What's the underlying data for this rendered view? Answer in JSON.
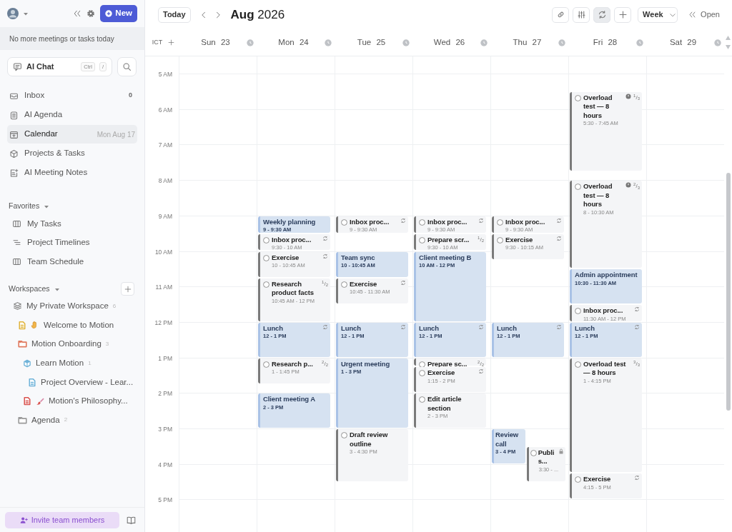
{
  "sidebar": {
    "new_button": "New",
    "banner": "No more meetings or tasks today",
    "ai_chat": {
      "label": "AI Chat",
      "shortcut": [
        "Ctrl",
        "/"
      ]
    },
    "nav": [
      {
        "kind": "inbox",
        "label": "Inbox",
        "count": "0",
        "selected": false
      },
      {
        "kind": "agenda",
        "label": "AI Agenda",
        "selected": false
      },
      {
        "kind": "calendar",
        "label": "Calendar",
        "note": "Mon Aug 17",
        "selected": true
      },
      {
        "kind": "projects",
        "label": "Projects & Tasks",
        "selected": false
      },
      {
        "kind": "notes",
        "label": "AI Meeting Notes",
        "selected": false
      }
    ],
    "favorites": {
      "title": "Favorites",
      "items": [
        {
          "kind": "board",
          "label": "My Tasks"
        },
        {
          "kind": "timeline",
          "label": "Project Timelines"
        },
        {
          "kind": "board",
          "label": "Team Schedule"
        }
      ]
    },
    "workspaces": {
      "title": "Workspaces",
      "tree": [
        {
          "kind": "workspace",
          "label": "My Private Workspace",
          "count": "6",
          "children": [
            {
              "kind": "welcome",
              "color": "#e0b43c",
              "label": "Welcome to Motion"
            },
            {
              "kind": "folder",
              "color": "#e07a5f",
              "label": "Motion Onboarding",
              "count": "3",
              "children": [
                {
                  "kind": "project",
                  "color": "#6fb3d9",
                  "label": "Learn Motion",
                  "count": "1",
                  "children": [
                    {
                      "kind": "doc",
                      "color": "#6fb3d9",
                      "label": "Project Overview - Lear..."
                    }
                  ]
                },
                {
                  "kind": "philosophy",
                  "color": "#d9534f",
                  "label": "Motion's Philosophy..."
                }
              ]
            },
            {
              "kind": "folder",
              "color": "#9a9a9a",
              "label": "Agenda",
              "count": "2"
            }
          ]
        }
      ]
    },
    "invite": "Invite team members"
  },
  "toolbar": {
    "today": "Today",
    "title": "**Aug** 2026",
    "tools": [
      {
        "kind": "link",
        "selected": false
      },
      {
        "kind": "sliders",
        "selected": false
      },
      {
        "kind": "sync",
        "selected": true
      },
      {
        "kind": "plus",
        "selected": false
      }
    ],
    "view": "Week",
    "open": "Open"
  },
  "timezone": "ICT",
  "hours": [
    "5 AM",
    "6 AM",
    "7 AM",
    "8 AM",
    "9 AM",
    "10 AM",
    "11 AM",
    "12 PM",
    "1 PM",
    "2 PM",
    "3 PM",
    "4 PM",
    "5 PM"
  ],
  "days": [
    {
      "label": "Sun 23"
    },
    {
      "label": "Mon 24",
      "events": [
        {
          "kind": "event",
          "title": "Weekly planning",
          "time": "9 - 9:30 AM"
        },
        {
          "kind": "task",
          "checked": false,
          "title": "Inbox proc...",
          "time": "9:30 - 10 AM",
          "recurring": true
        },
        {
          "kind": "task",
          "checked": false,
          "title": "Exercise",
          "time": "10 - 10:45 AM",
          "recurring": true
        },
        {
          "kind": "task",
          "checked": false,
          "title": "Research product facts",
          "time": "10:45 AM - 12 PM",
          "fraction": "$^{1}$/$_{2}$"
        },
        {
          "kind": "event",
          "title": "Lunch",
          "time": "12 - 1 PM",
          "recurring": true
        },
        {
          "kind": "task",
          "checked": false,
          "title": "Research p...",
          "time": "1 - 1:45 PM",
          "fraction": "$^{2}$/$_{2}$"
        },
        {
          "kind": "event",
          "title": "Client meeting A",
          "time": "2 - 3 PM"
        }
      ]
    },
    {
      "label": "Tue 25",
      "events": [
        {
          "kind": "task",
          "checked": false,
          "title": "Inbox proc...",
          "time": "9 - 9:30 AM",
          "recurring": true
        },
        {
          "kind": "event",
          "title": "Team sync",
          "time": "10 - 10:45 AM"
        },
        {
          "kind": "task",
          "checked": false,
          "title": "Exercise",
          "time": "10:45 - 11:30 AM",
          "recurring": true
        },
        {
          "kind": "event",
          "title": "Lunch",
          "time": "12 - 1 PM",
          "recurring": true
        },
        {
          "kind": "event",
          "title": "Urgent meeting",
          "time": "1 - 3 PM"
        },
        {
          "kind": "task",
          "checked": false,
          "title": "Draft review outline",
          "time": "3 - 4:30 PM"
        }
      ]
    },
    {
      "label": "Wed 26",
      "events": [
        {
          "kind": "task",
          "checked": false,
          "title": "Inbox proc...",
          "time": "9 - 9:30 AM",
          "recurring": true
        },
        {
          "kind": "task",
          "checked": false,
          "title": "Prepare scr...",
          "time": "9:30 - 10 AM",
          "fraction": "$^{1}$/$_{2}$"
        },
        {
          "kind": "event",
          "title": "Client meeting B",
          "time": "10 AM - 12 PM"
        },
        {
          "kind": "event",
          "title": "Lunch",
          "time": "12 - 1 PM",
          "recurring": true
        },
        {
          "kind": "task",
          "checked": false,
          "title": "Prepare sc...",
          "fraction": "$^{2}$/$_{2}$"
        },
        {
          "kind": "task",
          "checked": false,
          "title": "Exercise",
          "time": "1:15 - 2 PM",
          "recurring": true
        },
        {
          "kind": "task",
          "checked": false,
          "title": "Edit article section",
          "time": "2 - 3 PM"
        }
      ]
    },
    {
      "label": "Thu 27",
      "events": [
        {
          "kind": "task",
          "checked": false,
          "title": "Inbox proc...",
          "time": "9 - 9:30 AM",
          "recurring": true
        },
        {
          "kind": "task",
          "checked": false,
          "title": "Exercise",
          "time": "9:30 - 10:15 AM",
          "recurring": true
        },
        {
          "kind": "event",
          "title": "Lunch",
          "time": "12 - 1 PM",
          "recurring": true
        },
        {
          "kind": "event",
          "title": "Review call",
          "time": "3 - 4 PM"
        },
        {
          "kind": "task",
          "checked": false,
          "title": "Publis...",
          "time": "3:30 - ...",
          "locked": true
        }
      ]
    },
    {
      "label": "Fri 28",
      "events": [
        {
          "kind": "task",
          "checked": false,
          "title": "Overload test — 8 hours",
          "time": "5:30 - 7:45 AM",
          "alert": true,
          "fraction": "$^{1}$/$_{3}$"
        },
        {
          "kind": "task",
          "checked": false,
          "title": "Overload test — 8 hours",
          "time": "8 - 10:30 AM",
          "alert": true,
          "fraction": "$^{2}$/$_{3}$"
        },
        {
          "kind": "event",
          "title": "Admin appointment",
          "time": "10:30 - 11:30 AM"
        },
        {
          "kind": "task",
          "checked": false,
          "title": "Inbox proc...",
          "time": "11:30 AM - 12 PM",
          "recurring": true
        },
        {
          "kind": "event",
          "title": "Lunch",
          "time": "12 - 1 PM",
          "recurring": true
        },
        {
          "kind": "task",
          "checked": false,
          "title": "Overload test — 8 hours",
          "time": "1 - 4:15 PM",
          "fraction": "$^{3}$/$_{3}$"
        },
        {
          "kind": "task",
          "checked": false,
          "title": "Exercise",
          "time": "4:15 - 5 PM",
          "recurring": true
        }
      ]
    },
    {
      "label": "Sat 29"
    }
  ]
}
